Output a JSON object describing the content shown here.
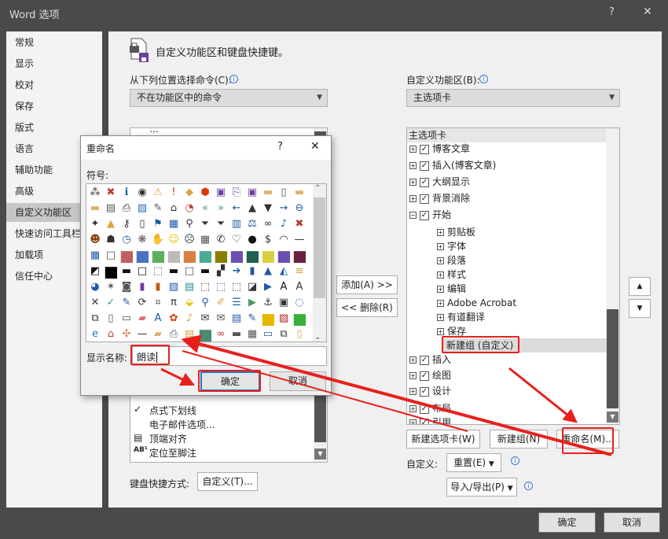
{
  "window": {
    "title": "Word 选项",
    "help": "?",
    "close": "✕"
  },
  "nav": {
    "items": [
      "常规",
      "显示",
      "校对",
      "保存",
      "版式",
      "语言",
      "辅助功能",
      "高级",
      "自定义功能区",
      "快速访问工具栏",
      "加载项",
      "信任中心"
    ],
    "selected": "自定义功能区"
  },
  "main": {
    "header": "自定义功能区和键盘快捷键。",
    "choose_label": "从下列位置选择命令(C):",
    "choose_value": "不在功能区中的命令",
    "ribbon_label": "自定义功能区(B):",
    "ribbon_value": "主选项卡",
    "commands": [
      {
        "icon": "",
        "label": "…"
      },
      {
        "icon": "check-icon",
        "label": "点式下划线"
      },
      {
        "icon": "",
        "label": "电子邮件选项..."
      },
      {
        "icon": "align-top-icon",
        "label": "顶端对齐"
      },
      {
        "icon": "footnote-icon",
        "label": "定位至脚注"
      }
    ],
    "add_button": "添加(A) >>",
    "remove_button": "<< 删除(R)",
    "keyboard_label": "键盘快捷方式:",
    "keyboard_button": "自定义(T)...",
    "tree_header": "主选项卡",
    "tree": [
      {
        "label": "博客文章",
        "level": 0,
        "expanded": false,
        "checked": true
      },
      {
        "label": "插入(博客文章)",
        "level": 0,
        "expanded": false,
        "checked": true
      },
      {
        "label": "大纲显示",
        "level": 0,
        "expanded": false,
        "checked": true
      },
      {
        "label": "背景消除",
        "level": 0,
        "expanded": false,
        "checked": true
      },
      {
        "label": "开始",
        "level": 0,
        "expanded": true,
        "checked": true
      },
      {
        "label": "剪贴板",
        "level": 1
      },
      {
        "label": "字体",
        "level": 1
      },
      {
        "label": "段落",
        "level": 1
      },
      {
        "label": "样式",
        "level": 1
      },
      {
        "label": "编辑",
        "level": 1
      },
      {
        "label": "Adobe Acrobat",
        "level": 1
      },
      {
        "label": "有道翻译",
        "level": 1
      },
      {
        "label": "保存",
        "level": 1
      },
      {
        "label": "新建组 (自定义)",
        "level": 1,
        "selected": true
      },
      {
        "label": "插入",
        "level": 0,
        "expanded": false,
        "checked": true
      },
      {
        "label": "绘图",
        "level": 0,
        "expanded": false,
        "checked": true
      },
      {
        "label": "设计",
        "level": 0,
        "expanded": false,
        "checked": true
      },
      {
        "label": "布局",
        "level": 0,
        "expanded": false,
        "checked": true
      },
      {
        "label": "引用",
        "level": 0,
        "expanded": false,
        "checked": true
      }
    ],
    "new_tab_button": "新建选项卡(W)",
    "new_group_button": "新建组(N)",
    "rename_button": "重命名(M)...",
    "customize_label": "自定义:",
    "reset_button": "重置(E)",
    "import_export_button": "导入/导出(P)"
  },
  "dialog": {
    "title": "重命名",
    "help": "?",
    "close": "✕",
    "symbol_label": "符号:",
    "display_name_label": "显示名称:",
    "display_name_value": "朗读",
    "ok": "确定",
    "cancel": "取消",
    "symbols": [
      "⁂|#333",
      "✖|#c0392b",
      "ℹ|#1e5aa8",
      "◉|#333",
      "⚠|#d9a441",
      "!|#c0392b",
      "◆|#d9a441",
      "⬢|#d83b01",
      "▣|#6b3fa0",
      "⎘|#6b3fa0",
      "▣|#6b3fa0",
      "▬|#dcb46e",
      "▯|#555",
      "▬|#dcb46e",
      "▬|#dcb46e",
      "▤|#555",
      "⎙|#333",
      "▨|#2a6bb0",
      "✎|#555",
      "⌂|#333",
      "◔|#c0392b",
      "«|#4a9a6a",
      "»|#4a9a6a",
      "←|#1e5aa8",
      "▲|#333",
      "▼|#333",
      "→|#1e5aa8",
      "⊖|#1e5aa8",
      "✦|#333",
      "▲|#d9a441",
      "⚷|#333",
      "▯|#333",
      "⚑|#1e5aa8",
      "▦|#1e5aa8",
      "⚲|#333",
      "⏷|#333",
      "⏷|#333",
      "▥|#1e5aa8",
      "⚖|#1e5aa8",
      "∞|#333",
      "♪|#1e5aa8",
      "✖|#c0392b",
      "☻|#8b4513",
      "☗|#333",
      "◷|#1e5aa8",
      "❋|#555",
      "✋|#555",
      "☺|#e6c200",
      "☹|#333",
      "▦|#555",
      "✆|#333",
      "♡|#333",
      "●|#111",
      "$|#333",
      "◠|#333",
      "—|#333",
      "▦|#1e5aa8",
      "□|#555",
      "■|#c06060",
      "■|#4a72c4",
      "■|#5cb05c",
      "■|#bbbbbb",
      "■|#d98040",
      "■|#4aab96",
      "■|#8a8000",
      "■|#6b4fb0",
      "■|#1e6050",
      "■|#d8d040",
      "■|#6b4fb0",
      "■|#6b2040",
      "◩|#111",
      "■|#000",
      "▬|#111",
      "□|#111",
      "⬚|#555",
      "▬|#111",
      "□|#555",
      "▬|#111",
      "▞|#333",
      "➔|#1e5aa8",
      "▮|#1e5aa8",
      "▲|#1e5aa8",
      "◭|#1e5aa8",
      "≡|#d9a441",
      "◕|#1e5aa8",
      "✶|#555",
      "◙|#555",
      "▮|#6b3fa0",
      "▮|#c05a10",
      "▧|#1e5aa8",
      "▤|#2a8aa0",
      "⬚|#333",
      "⬚|#1e5aa8",
      "⬚|#333",
      "◪|#333",
      "▶|#1e5aa8",
      "A|#111",
      "A|#333",
      "✕|#333",
      "✓|#4a9a6a",
      "✎|#1e5aa8",
      "⟳|#333",
      "⌗|#333",
      "π|#333",
      "⬙|#e6c200",
      "⚲|#1e5aa8",
      "✐|#d9a441",
      "☰|#1e5aa8",
      "▶|#4a9a6a",
      "⚓|#333",
      "▣|#333",
      "◌|#1e5aa8",
      "⧉|#333",
      "▯|#555",
      "▭|#555",
      "▰|#e07070",
      "A|#1e5aa8",
      "✿|#d83b01",
      "♪|#d9a441",
      "✉|#333",
      "✉|#555",
      "▤|#1e5aa8",
      "✎|#1e5aa8",
      "■|#e6b800",
      "▨|#b02020",
      "■|#3aae3a",
      "e|#1e78c8",
      "⌂|#c0392b",
      "✣|#d98040",
      "—|#333",
      "▰|#dcb46e",
      "⎙|#555",
      "▤|#d9a441",
      "■|#4a8a70",
      "∞|#c0392b",
      "▬|#555",
      "▦|#555",
      "▭|#1e5aa8",
      "⧉|#333",
      "▯|#d9a441"
    ]
  },
  "buttons": {
    "ok": "确定",
    "cancel": "取消"
  },
  "colors": {
    "annotation": "#e8201c",
    "accent": "#1e5aa8"
  }
}
